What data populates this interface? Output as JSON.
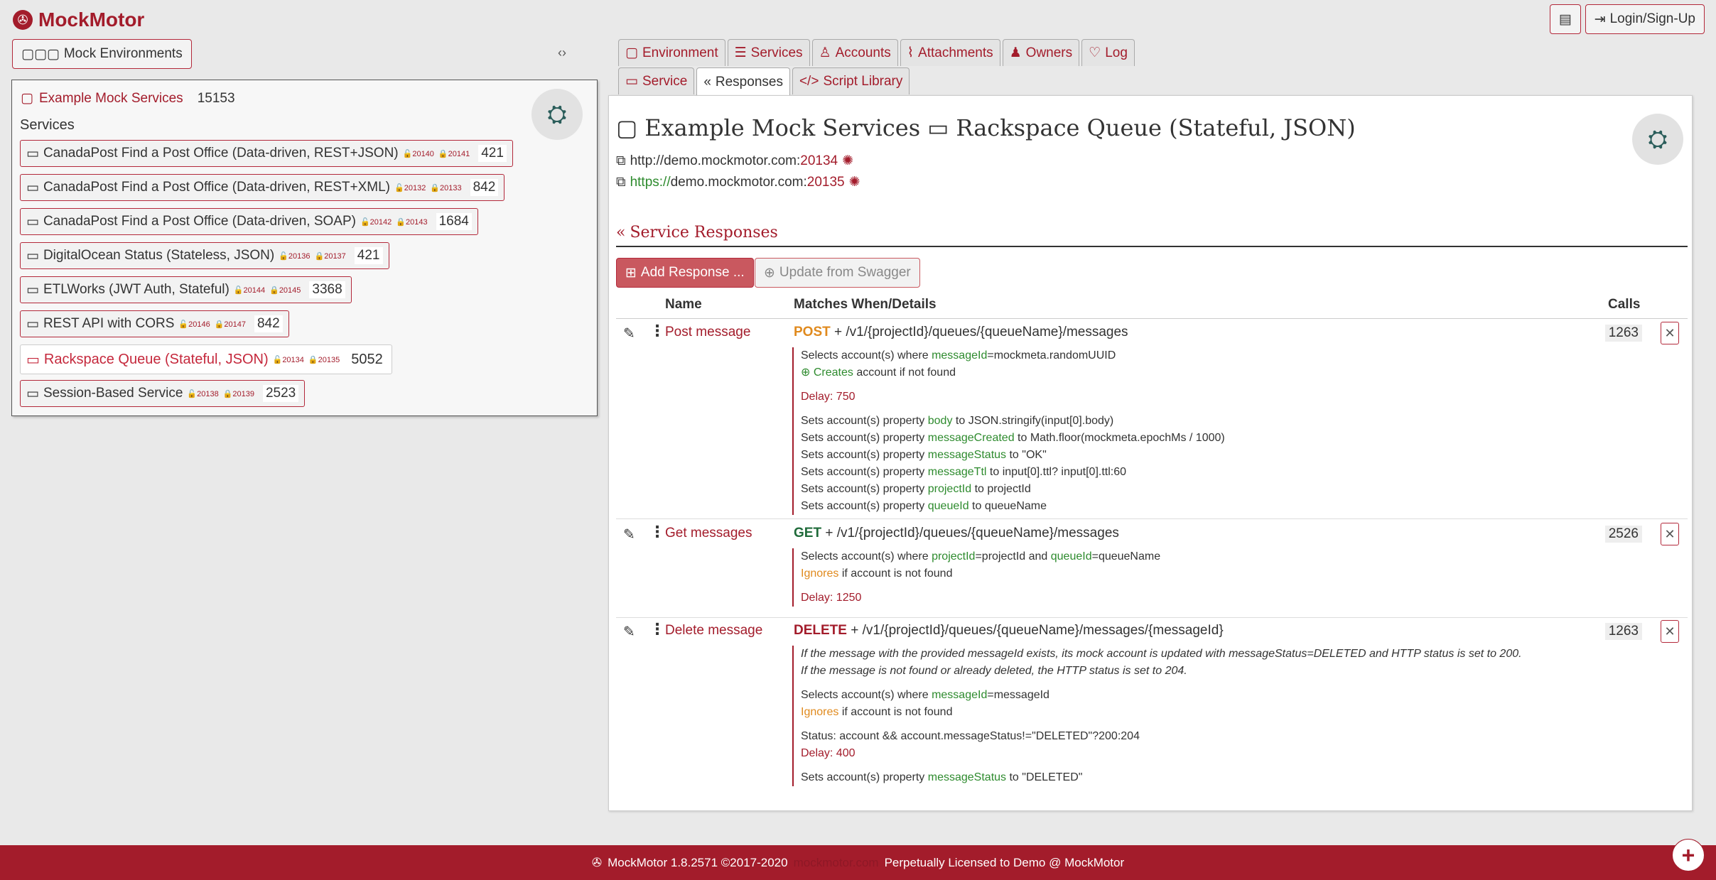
{
  "app": {
    "name": "MockMotor"
  },
  "header": {
    "notes_icon": "book-icon",
    "login_label": "Login/Sign-Up"
  },
  "left": {
    "mock_env_label": "Mock Environments",
    "env": {
      "name": "Example Mock Services",
      "count": "15153"
    },
    "services_label": "Services",
    "services": [
      {
        "name": "CanadaPost Find a Post Office (Data-driven, REST+JSON)",
        "port1": "20140",
        "port2": "20141",
        "calls": "421"
      },
      {
        "name": "CanadaPost Find a Post Office (Data-driven, REST+XML)",
        "port1": "20132",
        "port2": "20133",
        "calls": "842"
      },
      {
        "name": "CanadaPost Find a Post Office (Data-driven, SOAP)",
        "port1": "20142",
        "port2": "20143",
        "calls": "1684"
      },
      {
        "name": "DigitalOcean Status (Stateless, JSON)",
        "port1": "20136",
        "port2": "20137",
        "calls": "421"
      },
      {
        "name": "ETLWorks (JWT Auth, Stateful)",
        "port1": "20144",
        "port2": "20145",
        "calls": "3368"
      },
      {
        "name": "REST API with CORS",
        "port1": "20146",
        "port2": "20147",
        "calls": "842"
      },
      {
        "name": "Rackspace Queue (Stateful, JSON)",
        "port1": "20134",
        "port2": "20135",
        "calls": "5052"
      },
      {
        "name": "Session-Based Service",
        "port1": "20138",
        "port2": "20139",
        "calls": "2523"
      }
    ]
  },
  "tabs": {
    "row1": [
      "Environment",
      "Services",
      "Accounts",
      "Attachments",
      "Owners",
      "Log"
    ],
    "row2": [
      "Service",
      "Responses",
      "Script Library"
    ]
  },
  "main": {
    "env_name": "Example Mock Services",
    "service_name": "Rackspace Queue (Stateful, JSON)",
    "http_url": "http://demo.mockmotor.com:",
    "http_port": "20134",
    "https_scheme": "https://",
    "https_host": "demo.mockmotor.com:",
    "https_port": "20135",
    "section_title": "Service Responses",
    "add_response_label": "Add Response ...",
    "update_swagger_label": "Update from Swagger",
    "col_name": "Name",
    "col_matches": "Matches When/Details",
    "col_calls": "Calls"
  },
  "responses": [
    {
      "name": "Post message",
      "method": "POST",
      "path": "+ /v1/{projectId}/queues/{queueName}/messages",
      "calls": "1263",
      "select_prefix": "Selects account(s) where ",
      "select_field": "messageId",
      "select_rest": "=mockmeta.randomUUID",
      "notfound_action": "Creates",
      "notfound_rest": " account if not found",
      "delay": "Delay: 750",
      "props": [
        {
          "prefix": "Sets account(s) property ",
          "field": "body",
          "rest": " to JSON.stringify(input[0].body)"
        },
        {
          "prefix": "Sets account(s) property ",
          "field": "messageCreated",
          "rest": " to Math.floor(mockmeta.epochMs / 1000)"
        },
        {
          "prefix": "Sets account(s) property ",
          "field": "messageStatus",
          "rest": " to \"OK\""
        },
        {
          "prefix": "Sets account(s) property ",
          "field": "messageTtl",
          "rest": " to input[0].ttl? input[0].ttl:60"
        },
        {
          "prefix": "Sets account(s) property ",
          "field": "projectId",
          "rest": " to projectId"
        },
        {
          "prefix": "Sets account(s) property ",
          "field": "queueId",
          "rest": " to queueName"
        }
      ]
    },
    {
      "name": "Get messages",
      "method": "GET",
      "path": "+ /v1/{projectId}/queues/{queueName}/messages",
      "calls": "2526",
      "select_prefix": "Selects account(s) where ",
      "select_field": "projectId",
      "select_mid": "=projectId and ",
      "select_field2": "queueId",
      "select_rest": "=queueName",
      "notfound_action": "Ignores",
      "notfound_rest": " if account is not found",
      "delay": "Delay: 1250"
    },
    {
      "name": "Delete message",
      "method": "DELETE",
      "path": "+ /v1/{projectId}/queues/{queueName}/messages/{messageId}",
      "calls": "1263",
      "note1": "If the message with the provided messageId exists, its mock account is updated with messageStatus=DELETED and HTTP status is set to 200.",
      "note2": "If the message is not found or already deleted, the HTTP status is set to 204.",
      "select_prefix": "Selects account(s) where ",
      "select_field": "messageId",
      "select_rest": "=messageId",
      "notfound_action": "Ignores",
      "notfound_rest": " if account is not found",
      "status": "Status: account && account.messageStatus!=\"DELETED\"?200:204",
      "delay": "Delay: 400",
      "prop_prefix": "Sets account(s) property ",
      "prop_field": "messageStatus",
      "prop_rest": " to \"DELETED\""
    }
  ],
  "footer": {
    "version": "MockMotor 1.8.2571 ©2017-2020",
    "site": "mockmotor.com",
    "license": "Perpetually Licensed to Demo @ MockMotor"
  },
  "colors": {
    "brand": "#a31c2b",
    "accent_green": "#2e8b2e",
    "post_orange": "#e08a1e",
    "get_green": "#1f6b3a"
  }
}
